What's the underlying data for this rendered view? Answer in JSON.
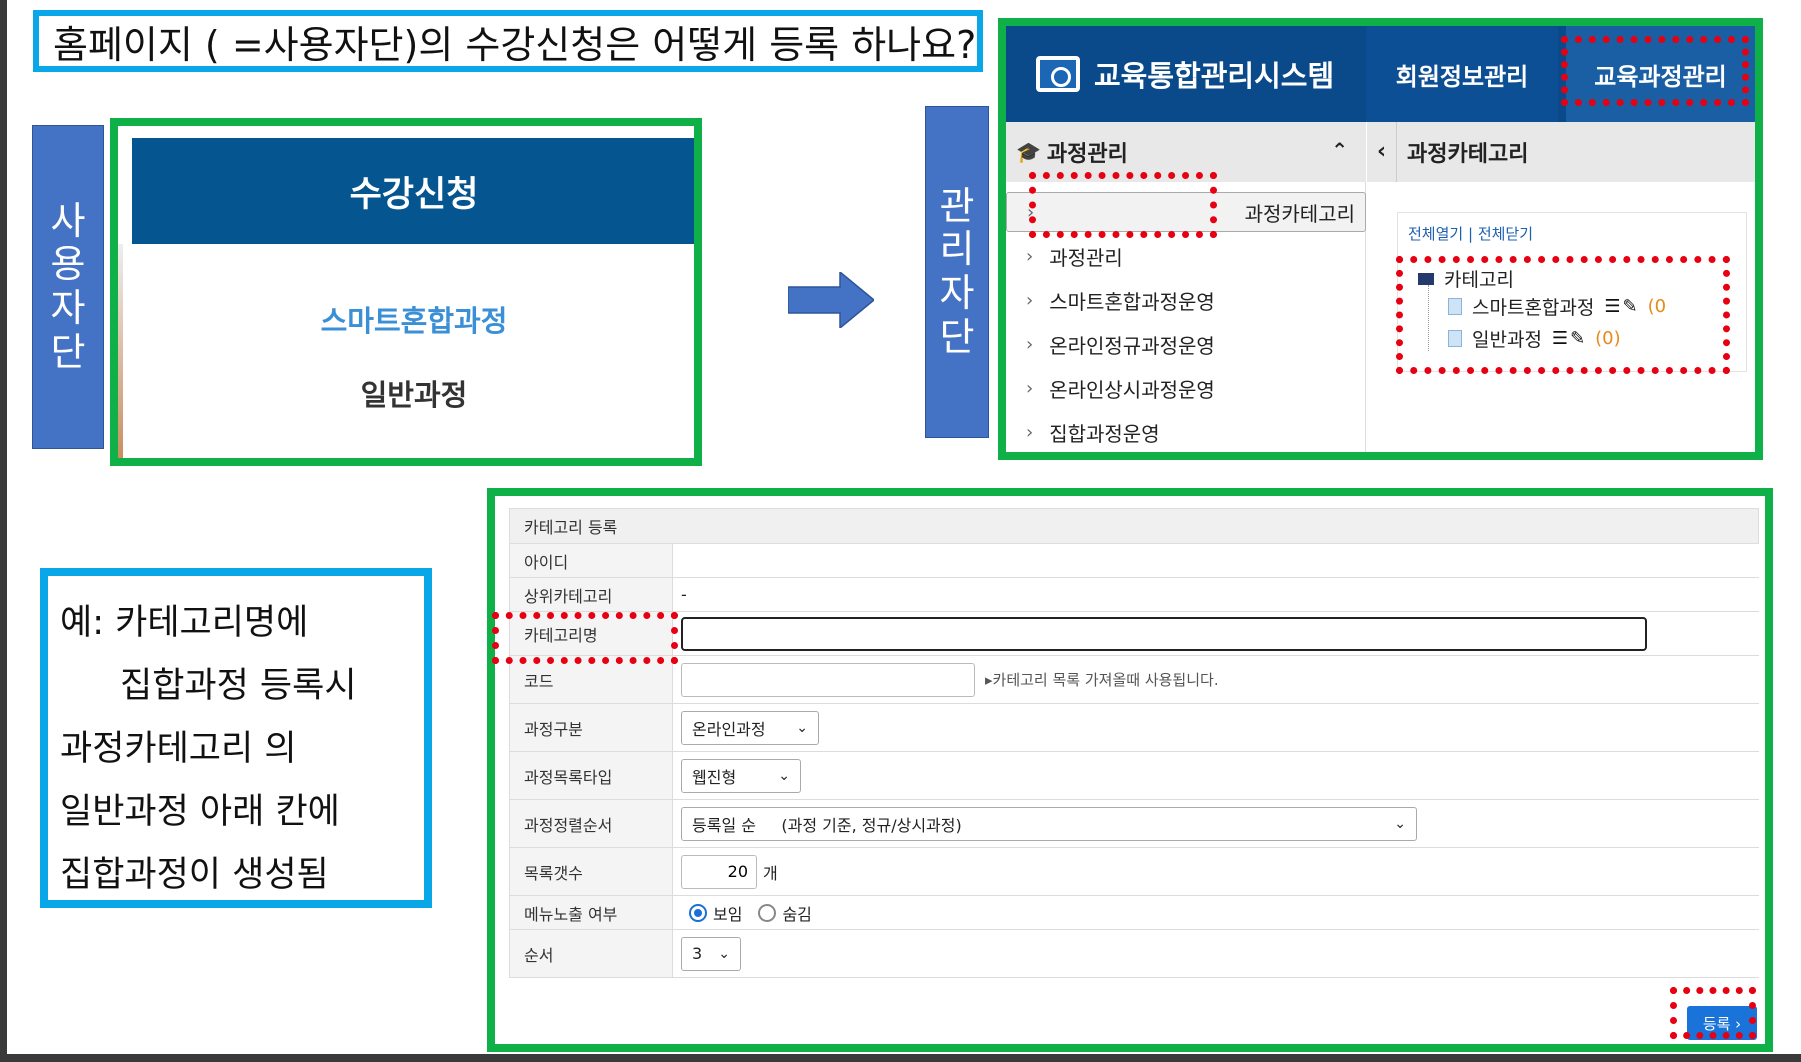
{
  "title": "홈페이지 ( =사용자단)의 수강신청은 어떻게 등록 하나요?",
  "labels": {
    "user": "사용자단",
    "admin": "관리자단"
  },
  "user_panel": {
    "header": "수강신청",
    "items": [
      "스마트혼합과정",
      "일반과정"
    ]
  },
  "admin_panel": {
    "brand": "교육통합관리시스템",
    "top_menu": [
      "회원정보관리",
      "교육과정관리"
    ],
    "sidebar": {
      "heading": "과정관리",
      "items": [
        "과정카테고리",
        "과정관리",
        "스마트혼합과정운영",
        "온라인정규과정운영",
        "온라인상시과정운영",
        "집합과정운영"
      ]
    },
    "main": {
      "heading": "과정카테고리",
      "expand_all": "전체열기",
      "separator": "|",
      "collapse_all": "전체닫기",
      "root": "카테고리",
      "nodes": [
        {
          "label": "스마트혼합과정",
          "count": "(0"
        },
        {
          "label": "일반과정",
          "count": "(0)"
        }
      ]
    }
  },
  "note": {
    "lines": [
      "예: 카테고리명에",
      "집합과정 등록시",
      "과정카테고리 의",
      "일반과정 아래 칸에",
      "집합과정이 생성됨"
    ]
  },
  "form": {
    "title": "카테고리 등록",
    "id_label": "아이디",
    "parent_label": "상위카테고리",
    "parent_value": "-",
    "name_label": "카테고리명",
    "name_value": "",
    "code_label": "코드",
    "code_hint": "▸카테고리 목록 가져올때 사용됩니다.",
    "type_label": "과정구분",
    "type_value": "온라인과정",
    "list_type_label": "과정목록타입",
    "list_type_value": "웹진형",
    "sort_label": "과정정렬순서",
    "sort_value": "등록일 순     (과정 기준, 정규/상시과정)",
    "count_label": "목록갯수",
    "count_value": "20",
    "count_unit": "개",
    "menu_label": "메뉴노출 여부",
    "menu_show": "보임",
    "menu_hide": "숨김",
    "order_label": "순서",
    "order_value": "3",
    "submit": "등록 ›"
  },
  "colors": {
    "accent_blue": "#0aa7e8",
    "green": "#10b049",
    "highlight_red": "#e60012",
    "label_blue": "#4472c4",
    "nav_navy": "#0b4a8a"
  }
}
